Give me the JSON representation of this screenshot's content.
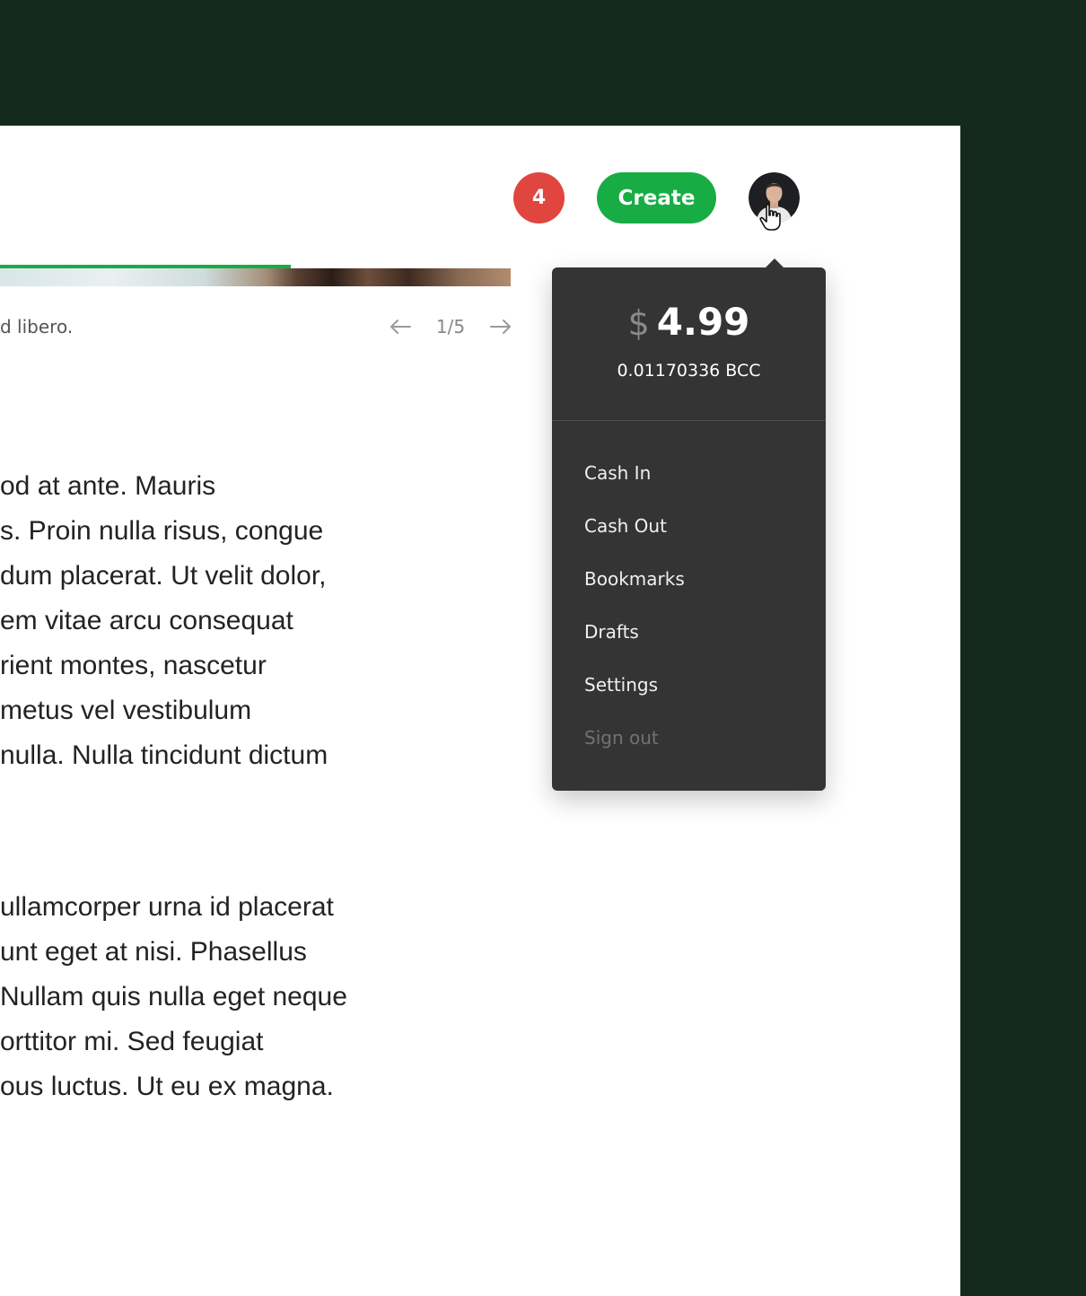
{
  "header": {
    "notification_count": "4",
    "create_label": "Create"
  },
  "media": {
    "progress_fraction": 0.57,
    "caption": "d libero.",
    "pager": "1/5"
  },
  "article": {
    "paragraph1": [
      "od at ante. Mauris",
      "s. Proin nulla risus, congue",
      "dum placerat. Ut velit dolor,",
      "em vitae arcu consequat",
      "rient montes, nascetur",
      "metus vel vestibulum",
      " nulla. Nulla tincidunt dictum"
    ],
    "paragraph2": [
      "ullamcorper urna id placerat",
      "unt eget at nisi. Phasellus",
      "Nullam quis nulla eget neque",
      "orttitor mi. Sed feugiat",
      "ous luctus. Ut eu ex magna."
    ]
  },
  "dropdown": {
    "currency_symbol": "$",
    "balance": "4.99",
    "crypto_balance": "0.01170336 BCC",
    "items": [
      {
        "label": "Cash In"
      },
      {
        "label": "Cash Out"
      },
      {
        "label": "Bookmarks"
      },
      {
        "label": "Drafts"
      },
      {
        "label": "Settings"
      },
      {
        "label": "Sign out"
      }
    ]
  },
  "colors": {
    "background_dark": "#132a1d",
    "accent_green": "#17ad44",
    "badge_red": "#e0463f",
    "dropdown_bg": "#343434"
  },
  "icons": {
    "prev": "arrow-left-icon",
    "next": "arrow-right-icon",
    "cursor": "hand-pointer-icon"
  }
}
